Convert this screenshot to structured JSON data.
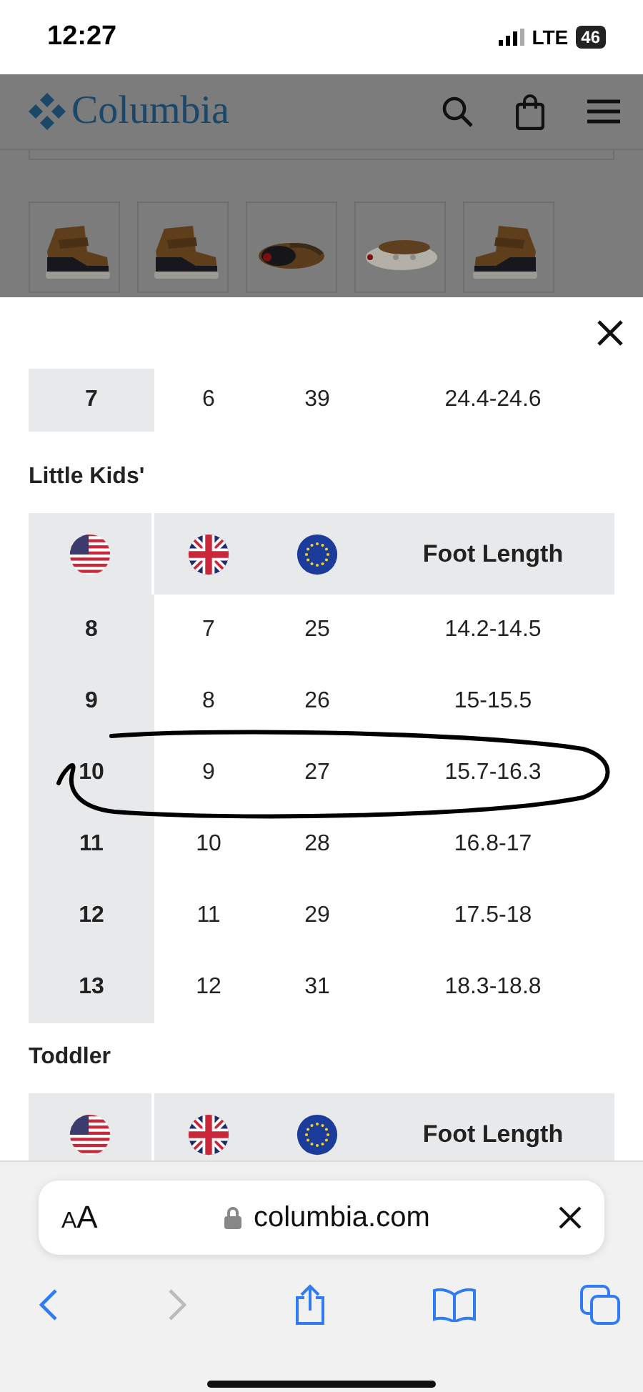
{
  "status_bar": {
    "time": "12:27",
    "network": "LTE",
    "battery": "46"
  },
  "header": {
    "logo": "Columbia"
  },
  "size_chart": {
    "sections": [
      {
        "rows": [
          {
            "cells": [
              "7",
              "6",
              "39",
              "24.4-24.6"
            ],
            "circled": false
          }
        ]
      },
      {
        "title": "Little Kids'",
        "columns": [
          {
            "kind": "flag-us"
          },
          {
            "kind": "flag-uk"
          },
          {
            "kind": "flag-eu"
          },
          {
            "kind": "text",
            "label": "Foot Length"
          }
        ],
        "rows": [
          {
            "cells": [
              "8",
              "7",
              "25",
              "14.2-14.5"
            ],
            "circled": false
          },
          {
            "cells": [
              "9",
              "8",
              "26",
              "15-15.5"
            ],
            "circled": false
          },
          {
            "cells": [
              "10",
              "9",
              "27",
              "15.7-16.3"
            ],
            "circled": true
          },
          {
            "cells": [
              "11",
              "10",
              "28",
              "16.8-17"
            ],
            "circled": false
          },
          {
            "cells": [
              "12",
              "11",
              "29",
              "17.5-18"
            ],
            "circled": false
          },
          {
            "cells": [
              "13",
              "12",
              "31",
              "18.3-18.8"
            ],
            "circled": false
          }
        ]
      },
      {
        "title": "Toddler",
        "columns": [
          {
            "kind": "flag-us"
          },
          {
            "kind": "flag-uk"
          },
          {
            "kind": "flag-eu"
          },
          {
            "kind": "text",
            "label": "Foot Length"
          }
        ]
      }
    ]
  },
  "browser": {
    "text_size": "AA",
    "url": "columbia.com",
    "back_disabled": false,
    "forward_disabled": true
  }
}
